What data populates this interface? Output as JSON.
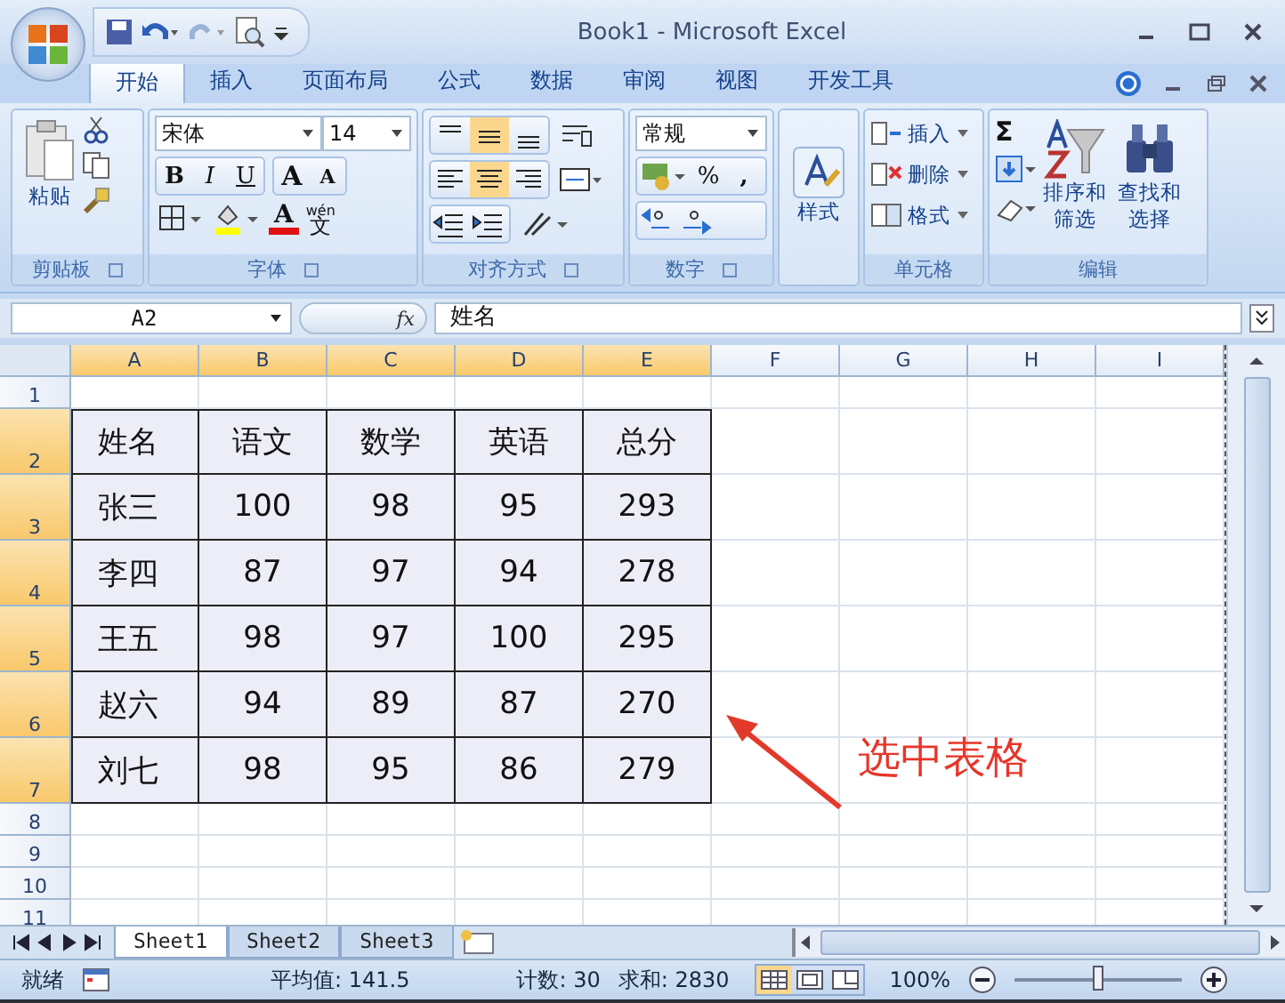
{
  "window": {
    "title": "Book1 - Microsoft Excel"
  },
  "tabs": [
    {
      "label": "开始",
      "selected": true
    },
    {
      "label": "插入",
      "selected": false
    },
    {
      "label": "页面布局",
      "selected": false
    },
    {
      "label": "公式",
      "selected": false
    },
    {
      "label": "数据",
      "selected": false
    },
    {
      "label": "审阅",
      "selected": false
    },
    {
      "label": "视图",
      "selected": false
    },
    {
      "label": "开发工具",
      "selected": false
    }
  ],
  "ribbon": {
    "clipboard": {
      "paste": "粘贴",
      "label": "剪贴板"
    },
    "font": {
      "font_name": "宋体",
      "font_size": "14",
      "format_buttons": [
        "B",
        "I",
        "U"
      ],
      "grow": "A",
      "shrink": "A",
      "font_color_letter": "A",
      "phonetic": "wén",
      "phonetic_char": "文",
      "label": "字体"
    },
    "alignment": {
      "vertical": [
        {
          "selected": false
        },
        {
          "selected": true
        },
        {
          "selected": false
        }
      ],
      "horizontal": [
        {
          "selected": false
        },
        {
          "selected": true
        },
        {
          "selected": false
        }
      ],
      "label": "对齐方式"
    },
    "number": {
      "format": "常规",
      "percent": "%",
      "comma": ",",
      "label": "数字"
    },
    "styles": {
      "label": "样式"
    },
    "cells": {
      "items": [
        "插入",
        "删除",
        "格式"
      ],
      "label": "单元格"
    },
    "editing": {
      "sum": "Σ",
      "buttons": [
        {
          "line1": "排序和",
          "line2": "筛选"
        },
        {
          "line1": "查找和",
          "line2": "选择"
        }
      ],
      "label": "编辑"
    }
  },
  "formula_bar": {
    "name_box": "A2",
    "fx": "fx",
    "value": "姓名"
  },
  "columns": [
    {
      "label": "A",
      "selected": true
    },
    {
      "label": "B",
      "selected": true
    },
    {
      "label": "C",
      "selected": true
    },
    {
      "label": "D",
      "selected": true
    },
    {
      "label": "E",
      "selected": true
    },
    {
      "label": "F",
      "selected": false
    },
    {
      "label": "G",
      "selected": false
    },
    {
      "label": "H",
      "selected": false
    },
    {
      "label": "I",
      "selected": false
    }
  ],
  "rows": [
    {
      "label": "1",
      "selected": false,
      "cells": []
    },
    {
      "label": "2",
      "selected": true,
      "cells": [
        "姓名",
        "语文",
        "数学",
        "英语",
        "总分"
      ]
    },
    {
      "label": "3",
      "selected": true,
      "cells": [
        "张三",
        "100",
        "98",
        "95",
        "293"
      ]
    },
    {
      "label": "4",
      "selected": true,
      "cells": [
        "李四",
        "87",
        "97",
        "94",
        "278"
      ]
    },
    {
      "label": "5",
      "selected": true,
      "cells": [
        "王五",
        "98",
        "97",
        "100",
        "295"
      ]
    },
    {
      "label": "6",
      "selected": true,
      "cells": [
        "赵六",
        "94",
        "89",
        "87",
        "270"
      ]
    },
    {
      "label": "7",
      "selected": true,
      "cells": [
        "刘七",
        "98",
        "95",
        "86",
        "279"
      ]
    },
    {
      "label": "8",
      "selected": false,
      "cells": []
    },
    {
      "label": "9",
      "selected": false,
      "cells": []
    },
    {
      "label": "10",
      "selected": false,
      "cells": []
    },
    {
      "label": "11",
      "selected": false,
      "cells": []
    }
  ],
  "sheet_tabs": [
    {
      "label": "Sheet1",
      "selected": true
    },
    {
      "label": "Sheet2",
      "selected": false
    },
    {
      "label": "Sheet3",
      "selected": false
    }
  ],
  "status_bar": {
    "ready": "就绪",
    "average": "平均值: 141.5",
    "count": "计数: 30",
    "sum": "求和: 2830",
    "views": [
      {
        "selected": true
      },
      {
        "selected": false
      },
      {
        "selected": false
      }
    ],
    "zoom": "100%",
    "zoom_slider": {
      "level": 0.5
    }
  },
  "annotation": {
    "text": "选中表格"
  }
}
